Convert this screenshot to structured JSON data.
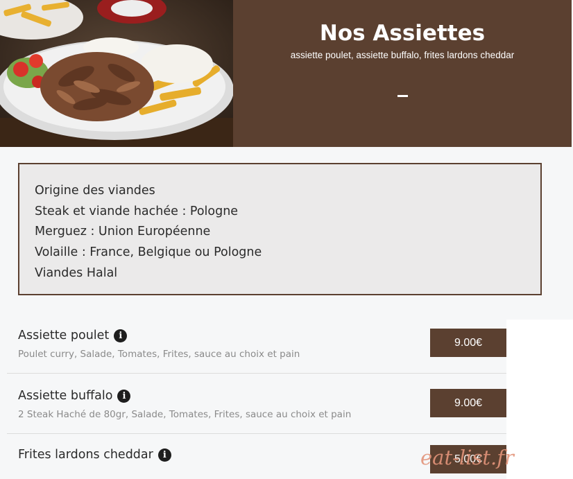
{
  "hero": {
    "title": "Nos Assiettes",
    "subtitle": "assiette poulet, assiette buffalo, frites lardons cheddar",
    "image_label": "photo-plate-kebab-fries"
  },
  "info_box": {
    "lines": [
      "Origine des viandes",
      "Steak et viande hachée : Pologne",
      "Merguez : Union Européenne",
      "Volaille : France, Belgique ou Pologne",
      "Viandes Halal"
    ]
  },
  "items": [
    {
      "name": "Assiette poulet",
      "description": "Poulet curry, Salade, Tomates, Frites, sauce au choix et pain",
      "price": "9.00€"
    },
    {
      "name": "Assiette buffalo",
      "description": "2 Steak Haché de 80gr, Salade, Tomates, Frites, sauce au choix et pain",
      "price": "9.00€"
    },
    {
      "name": "Frites lardons cheddar",
      "description": "",
      "price": "5.00€"
    }
  ],
  "info_icon_glyph": "i",
  "watermark": "eat-list.fr",
  "colors": {
    "brand_brown": "#5b4030",
    "box_bg": "#ebeaea",
    "page_bg": "#f6f7f8"
  }
}
